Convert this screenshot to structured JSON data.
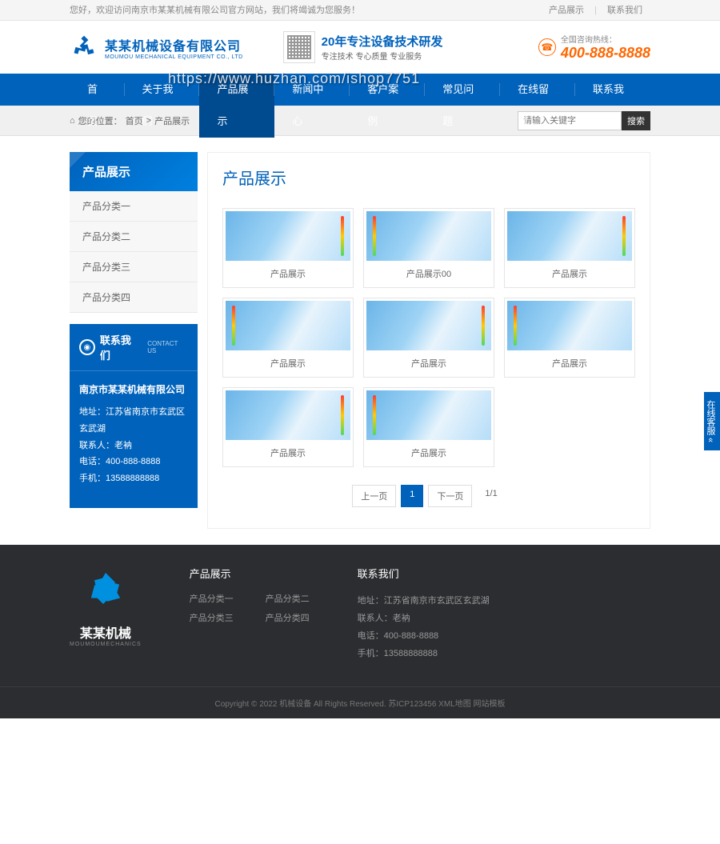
{
  "topbar": {
    "welcome": "您好，欢迎访问南京市某某机械有限公司官方网站，我们将竭诚为您服务！",
    "link_products": "产品展示",
    "link_contact": "联系我们"
  },
  "header": {
    "logo_cn": "某某机械设备有限公司",
    "logo_en": "MOUMOU MECHANICAL EQUIPMENT CO., LTD",
    "slogan_main": "20年专注设备技术研发",
    "slogan_sub": "专注技术 专心质量 专业服务",
    "hotline_label": "全国咨询热线：",
    "hotline_number": "400-888-8888"
  },
  "nav": {
    "items": [
      "首页",
      "关于我们",
      "产品展示",
      "新闻中心",
      "客户案例",
      "常见问题",
      "在线留言",
      "联系我们"
    ],
    "active_index": 2
  },
  "breadcrumb": {
    "label": "您的位置：",
    "home": "首页",
    "current": "产品展示"
  },
  "search": {
    "placeholder": "请输入关键字",
    "button": "搜索"
  },
  "sidebar": {
    "title": "产品展示",
    "items": [
      "产品分类一",
      "产品分类二",
      "产品分类三",
      "产品分类四"
    ],
    "contact": {
      "title_cn": "联系我们",
      "title_en": "CONTACT US",
      "company": "南京市某某机械有限公司",
      "address_label": "地址：",
      "address": "江苏省南京市玄武区玄武湖",
      "person_label": "联系人：",
      "person": "老衲",
      "tel_label": "电话：",
      "tel": "400-888-8888",
      "mobile_label": "手机：",
      "mobile": "13588888888"
    }
  },
  "content": {
    "title": "产品展示",
    "products": [
      {
        "name": "产品展示"
      },
      {
        "name": "产品展示00"
      },
      {
        "name": "产品展示"
      },
      {
        "name": "产品展示"
      },
      {
        "name": "产品展示"
      },
      {
        "name": "产品展示"
      },
      {
        "name": "产品展示"
      },
      {
        "name": "产品展示"
      }
    ],
    "pagination": {
      "prev": "上一页",
      "current": "1",
      "next": "下一页",
      "info": "1/1"
    }
  },
  "footer": {
    "logo_cn": "某某机械",
    "logo_en": "MOUMOUMECHANICS",
    "col1_title": "产品展示",
    "col1_links": [
      "产品分类一",
      "产品分类二",
      "产品分类三",
      "产品分类四"
    ],
    "col2_title": "联系我们",
    "contact": {
      "address_label": "地址：",
      "address": "江苏省南京市玄武区玄武湖",
      "person_label": "联系人：",
      "person": "老衲",
      "tel_label": "电话：",
      "tel": "400-888-8888",
      "mobile_label": "手机：",
      "mobile": "13588888888"
    },
    "copyright": "Copyright © 2022 机械设备 All Rights Reserved. 苏ICP123456 XML地图 网站模板"
  },
  "float_service": "在线客服 «",
  "watermark": "https://www.huzhan.com/ishop7751"
}
